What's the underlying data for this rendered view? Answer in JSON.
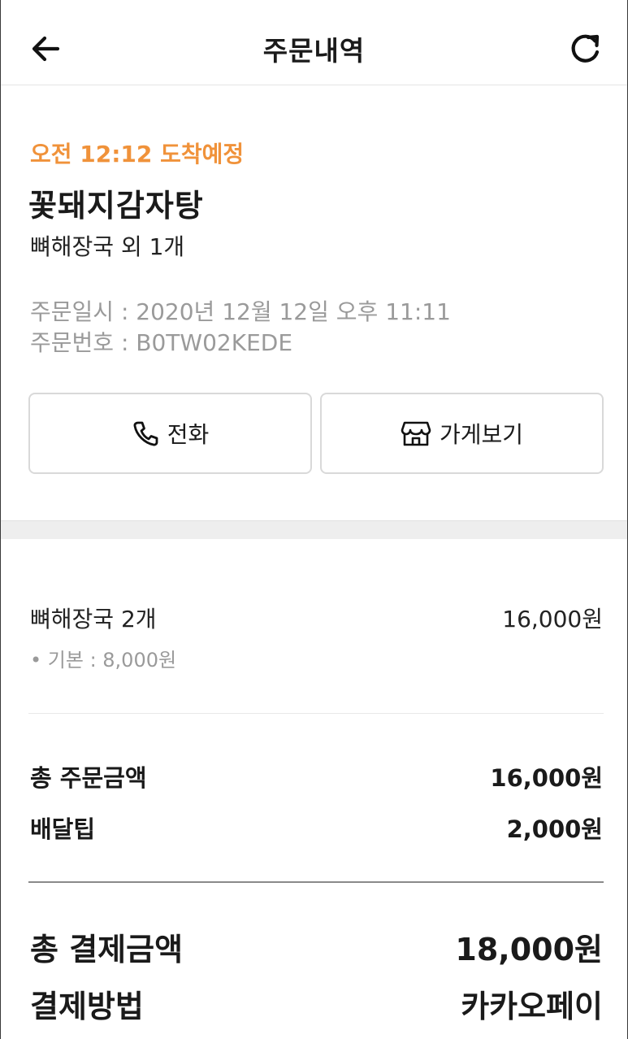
{
  "header": {
    "title": "주문내역",
    "back_icon": "arrow-left-icon",
    "refresh_icon": "refresh-icon"
  },
  "order": {
    "eta": "오전 12:12 도착예정",
    "store_name": "꽃돼지감자탕",
    "menu_summary": "뼈해장국 외 1개",
    "order_date": "주문일시 : 2020년 12월 12일 오후 11:11",
    "order_number": "주문번호 : B0TW02KEDE"
  },
  "actions": {
    "call_label": "전화",
    "call_icon": "phone-icon",
    "store_label": "가게보기",
    "store_icon": "storefront-icon"
  },
  "items": [
    {
      "name": "뼈해장국 2개",
      "price": "16,000원",
      "option": "• 기본 : 8,000원"
    }
  ],
  "summary": {
    "subtotal_label": "총 주문금액",
    "subtotal_value": "16,000원",
    "delivery_tip_label": "배달팁",
    "delivery_tip_value": "2,000원"
  },
  "payment": {
    "total_label": "총 결제금액",
    "total_value": "18,000원",
    "method_label": "결제방법",
    "method_value": "카카오페이"
  },
  "colors": {
    "accent": "#f0923a",
    "muted_text": "#9a9a9a",
    "border": "#d9d9d9"
  }
}
